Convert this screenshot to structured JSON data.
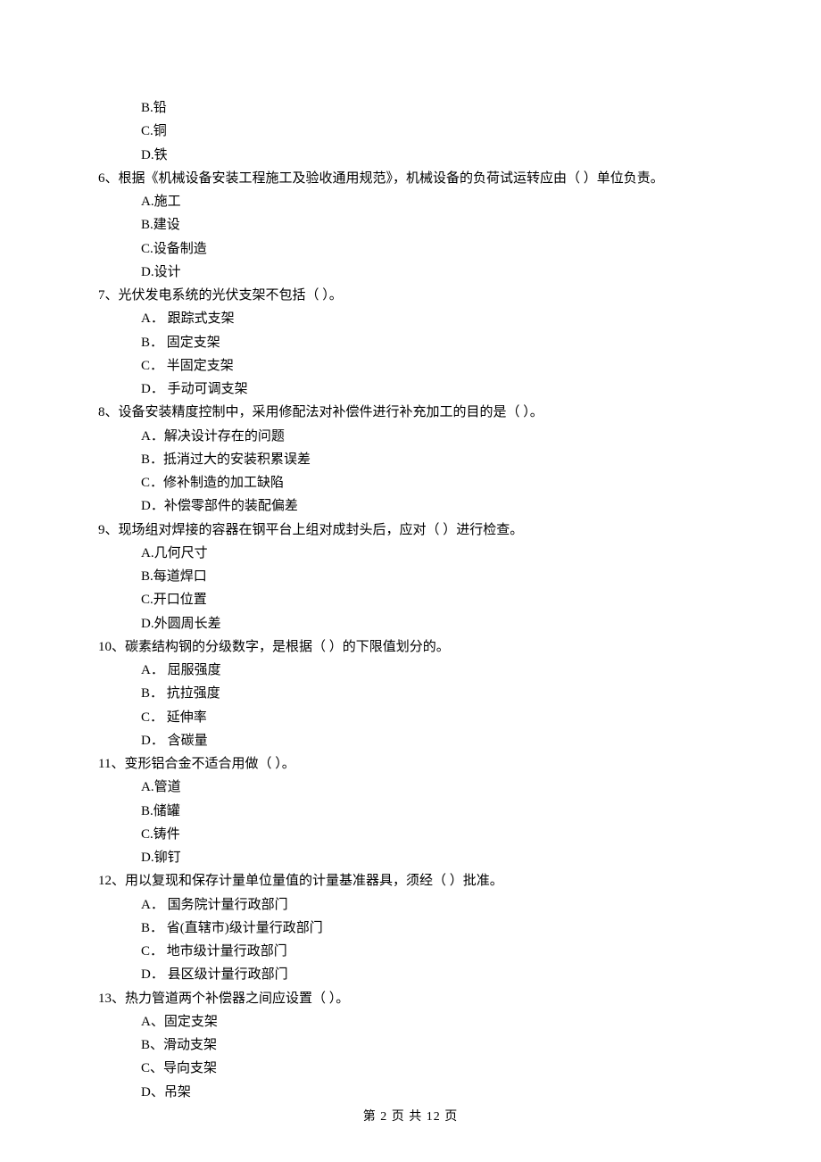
{
  "q5_options_tail": [
    "B.铅",
    "C.铜",
    "D.铁"
  ],
  "questions": [
    {
      "stem": "6、根据《机械设备安装工程施工及验收通用规范》，机械设备的负荷试运转应由（    ）单位负责。",
      "options": [
        "A.施工",
        "B.建设",
        "C.设备制造",
        "D.设计"
      ]
    },
    {
      "stem": "7、光伏发电系统的光伏支架不包括（    ）。",
      "options": [
        "A． 跟踪式支架",
        "B． 固定支架",
        "C． 半固定支架",
        "D． 手动可调支架"
      ]
    },
    {
      "stem": "8、设备安装精度控制中，采用修配法对补偿件进行补充加工的目的是（    ）。",
      "options": [
        "A．解决设计存在的问题",
        "B．抵消过大的安装积累误差",
        "C．修补制造的加工缺陷",
        "D．补偿零部件的装配偏差"
      ]
    },
    {
      "stem": "9、现场组对焊接的容器在钢平台上组对成封头后，应对（    ）进行检查。",
      "options": [
        "A.几何尺寸",
        "B.每道焊口",
        "C.开口位置",
        "D.外圆周长差"
      ]
    },
    {
      "stem": "10、碳素结构钢的分级数字，是根据（    ）的下限值划分的。",
      "options": [
        "A． 屈服强度",
        "B． 抗拉强度",
        "C． 延伸率",
        "D． 含碳量"
      ]
    },
    {
      "stem": "11、变形铝合金不适合用做（    ）。",
      "options": [
        "A.管道",
        "B.储罐",
        "C.铸件",
        "D.铆钉"
      ]
    },
    {
      "stem": "12、用以复现和保存计量单位量值的计量基准器具，须经（    ）批准。",
      "options": [
        "A． 国务院计量行政部门",
        "B． 省(直辖市)级计量行政部门",
        "C． 地市级计量行政部门",
        "D． 县区级计量行政部门"
      ]
    },
    {
      "stem": "13、热力管道两个补偿器之间应设置（    ）。",
      "options": [
        "A、固定支架",
        "B、滑动支架",
        "C、导向支架",
        "D、吊架"
      ]
    }
  ],
  "footer": "第 2 页 共 12 页"
}
